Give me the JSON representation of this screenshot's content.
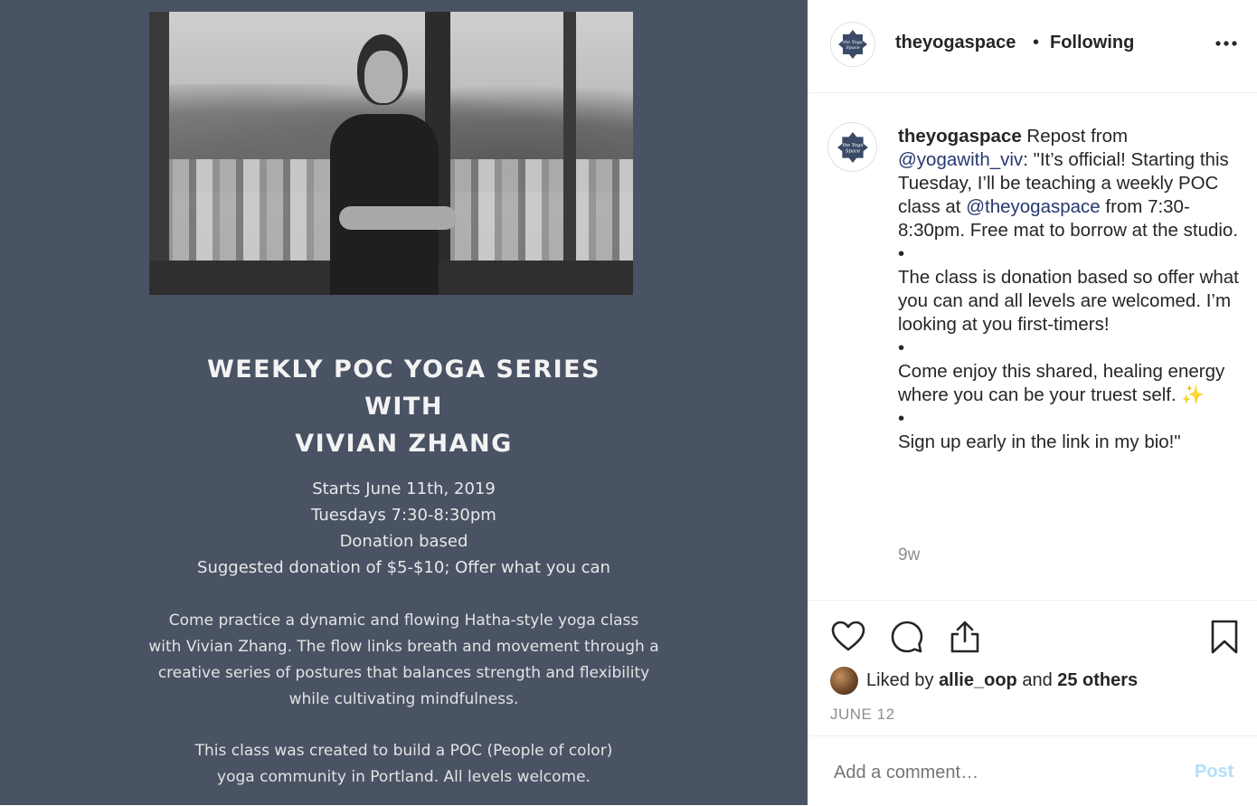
{
  "post_image": {
    "title_lines": [
      "WEEKLY POC YOGA SERIES",
      "WITH",
      "VIVIAN ZHANG"
    ],
    "details": [
      "Starts June 11th, 2019",
      "Tuesdays 7:30-8:30pm",
      "Donation based",
      "Suggested donation of $5-$10; Offer what you can"
    ],
    "paragraph1": [
      "Come practice a dynamic and flowing Hatha-style yoga class",
      "with Vivian Zhang. The flow links breath and movement through a",
      "creative series of postures that balances strength and flexibility",
      "while cultivating mindfulness."
    ],
    "paragraph2": [
      "This class was created to build a POC (People of color)",
      "yoga community in Portland. All levels welcome."
    ]
  },
  "header": {
    "username": "theyogaspace",
    "separator": "•",
    "follow_status": "Following",
    "avatar_text": "the Yoga Space"
  },
  "caption": {
    "username": "theyogaspace",
    "text_1": " Repost from ",
    "mention_1": "@yogawith_viv",
    "text_2": ": \"It’s official! Starting this Tuesday, I’ll be teaching a weekly POC class at ",
    "mention_2": "@theyogaspace",
    "text_3": " from 7:30-8:30pm. Free mat to borrow at the studio.",
    "bullet": "•",
    "text_4": "The class is donation based so offer what you can and all levels are welcomed. I’m looking at you first-timers!",
    "text_5": "Come enjoy this shared, healing energy where you can be your truest self. ✨",
    "text_6": "Sign up early in the link in my bio!\"",
    "time": "9w"
  },
  "likes": {
    "prefix": "Liked by ",
    "user": "allie_oop",
    "middle": " and ",
    "others": "25 others"
  },
  "date": "JUNE 12",
  "comment": {
    "placeholder": "Add a comment…",
    "post_label": "Post"
  },
  "colors": {
    "image_bg": "#4a5364",
    "mention": "#27386e",
    "post_disabled": "#b2dffc",
    "muted": "#8e8e8e"
  }
}
